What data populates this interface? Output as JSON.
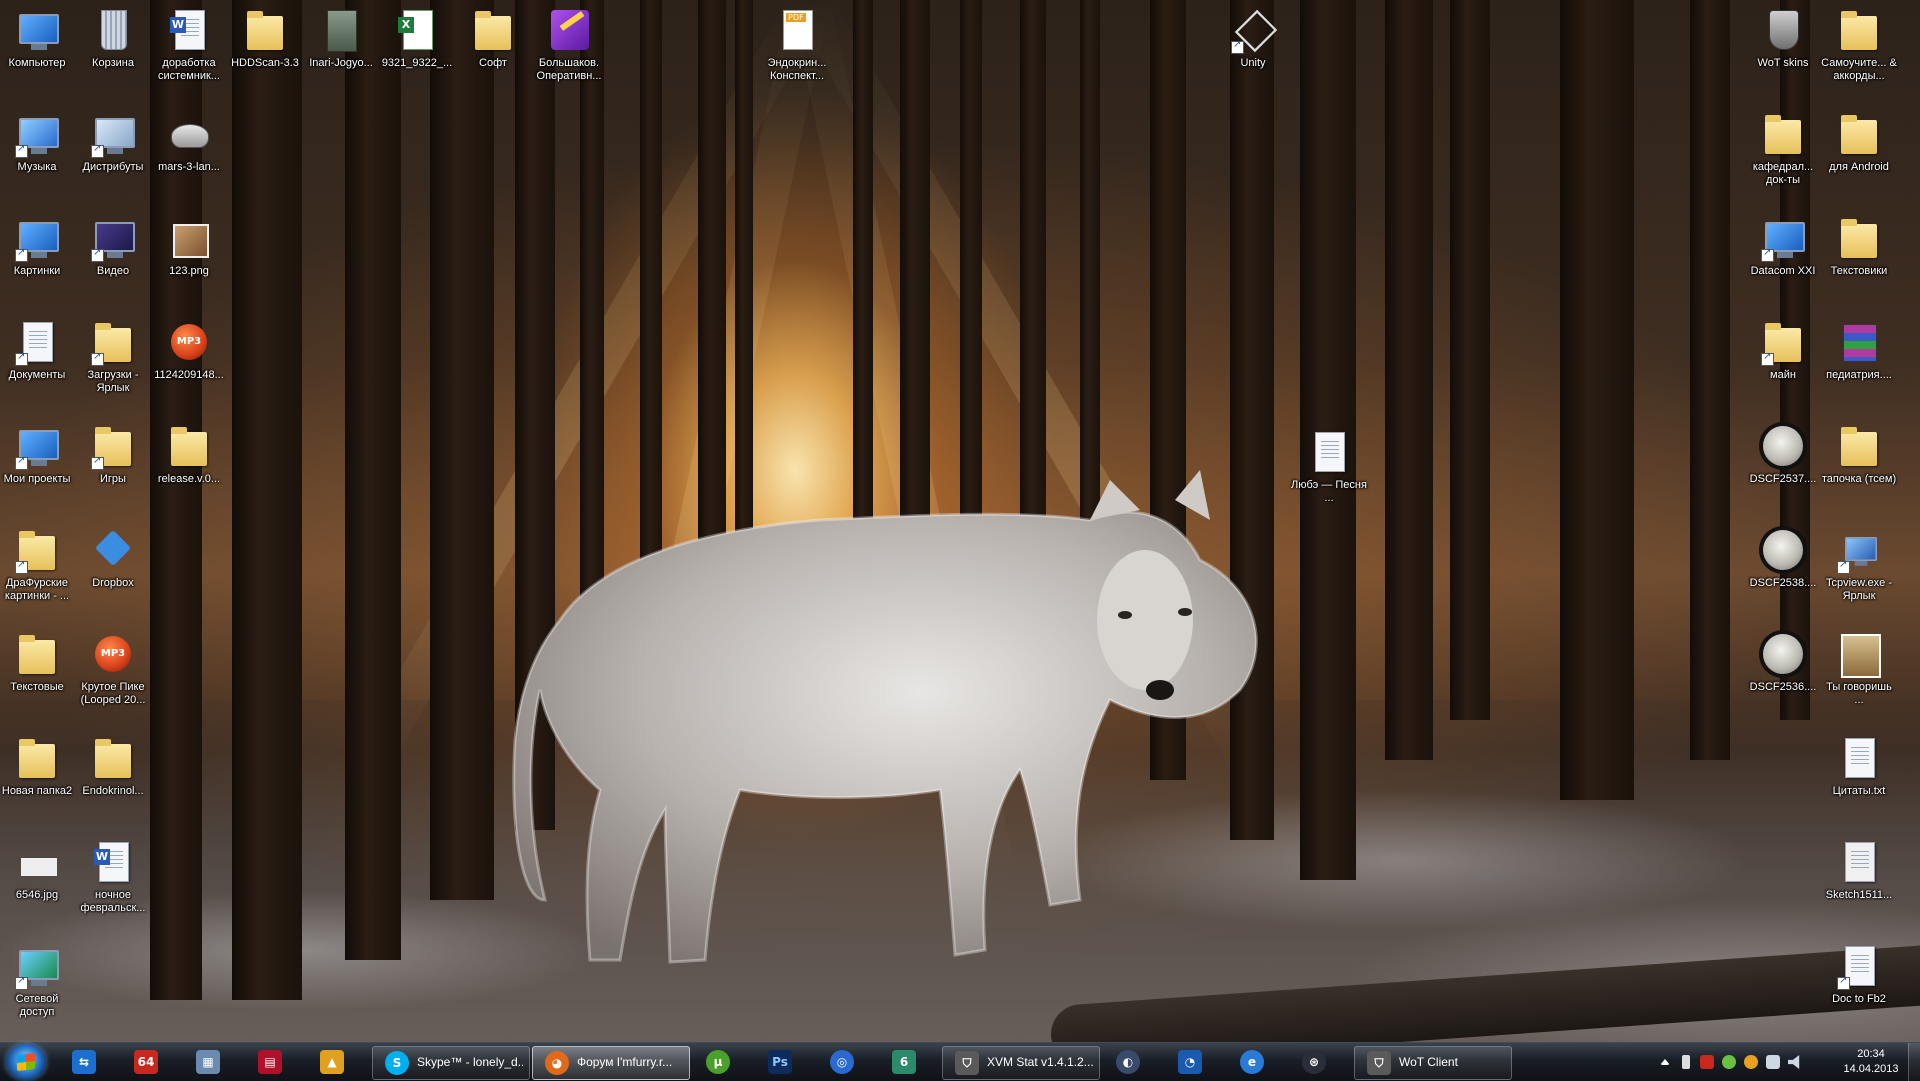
{
  "desktop": {
    "icons": [
      {
        "id": "computer",
        "label": "Компьютер",
        "icon": "computer-icon"
      },
      {
        "id": "recycle",
        "label": "Корзина",
        "icon": "recycle-bin-icon"
      },
      {
        "id": "dorabotka",
        "label": "доработка системник...",
        "icon": "word-document-icon"
      },
      {
        "id": "hddscan",
        "label": "HDDScan-3.3",
        "icon": "folder-icon"
      },
      {
        "id": "inari",
        "label": "Inari-Jogyo...",
        "icon": "game-icon"
      },
      {
        "id": "xls9321",
        "label": "9321_9322_...",
        "icon": "excel-document-icon"
      },
      {
        "id": "soft",
        "label": "Софт",
        "icon": "folder-icon"
      },
      {
        "id": "bolshakov",
        "label": "Большаков. Оперативн...",
        "icon": "onenote-icon"
      },
      {
        "id": "endokrin",
        "label": "Эндокрин... Конспект...",
        "icon": "pdf-icon"
      },
      {
        "id": "unity",
        "label": "Unity",
        "icon": "unity-icon"
      },
      {
        "id": "wotskins",
        "label": "WoT skins",
        "icon": "wot-icon"
      },
      {
        "id": "samouch",
        "label": "Самоучите... & аккорды...",
        "icon": "folder-icon"
      },
      {
        "id": "music",
        "label": "Музыка",
        "icon": "music-icon"
      },
      {
        "id": "distrib",
        "label": "Дистрибуты",
        "icon": "computer-icon"
      },
      {
        "id": "mars",
        "label": "mars-3-lan...",
        "icon": "game-icon"
      },
      {
        "id": "kafedral",
        "label": "кафедрал... док-ты",
        "icon": "folder-icon"
      },
      {
        "id": "android",
        "label": "для Android",
        "icon": "folder-icon"
      },
      {
        "id": "pictures",
        "label": "Картинки",
        "icon": "pictures-icon"
      },
      {
        "id": "video",
        "label": "Видео",
        "icon": "video-icon"
      },
      {
        "id": "png123",
        "label": "123.png",
        "icon": "image-icon"
      },
      {
        "id": "datacom",
        "label": "Datacom XXI",
        "icon": "network-icon"
      },
      {
        "id": "textoviki",
        "label": "Текстовики",
        "icon": "folder-icon"
      },
      {
        "id": "docs",
        "label": "Документы",
        "icon": "documents-icon"
      },
      {
        "id": "downloads",
        "label": "Загрузки - Ярлык",
        "icon": "folder-icon"
      },
      {
        "id": "mp3a",
        "label": "1124209148...",
        "icon": "mp3-icon"
      },
      {
        "id": "main",
        "label": "майн",
        "icon": "folder-icon"
      },
      {
        "id": "pediatr",
        "label": "педиатрия....",
        "icon": "winrar-icon"
      },
      {
        "id": "projects",
        "label": "Мои проекты",
        "icon": "computer-icon"
      },
      {
        "id": "games",
        "label": "Игры",
        "icon": "folder-icon"
      },
      {
        "id": "release",
        "label": "release.v.0...",
        "icon": "folder-icon"
      },
      {
        "id": "lyubz",
        "label": "Любэ — Песня ...",
        "icon": "text-document-icon"
      },
      {
        "id": "dscf2537",
        "label": "DSCF2537....",
        "icon": "moon-photo-icon"
      },
      {
        "id": "tapochka",
        "label": "тапочка (тсем)",
        "icon": "folder-icon"
      },
      {
        "id": "drafur",
        "label": "ДраФурские картинки - ...",
        "icon": "folder-icon"
      },
      {
        "id": "dropbox",
        "label": "Dropbox",
        "icon": "dropbox-icon"
      },
      {
        "id": "dscf2538",
        "label": "DSCF2538....",
        "icon": "moon-photo-icon"
      },
      {
        "id": "tcpview",
        "label": "Tcpview.exe - Ярлык",
        "icon": "network-icon"
      },
      {
        "id": "textovye",
        "label": "Текстовые",
        "icon": "folder-icon"
      },
      {
        "id": "krutoe",
        "label": "Крутое Пике (Looped 20...",
        "icon": "mp3-icon"
      },
      {
        "id": "dscf2536",
        "label": "DSCF2536....",
        "icon": "moon-photo-icon"
      },
      {
        "id": "ty",
        "label": "Ты говоришь ...",
        "icon": "image-icon"
      },
      {
        "id": "novaya",
        "label": "Новая папка2",
        "icon": "folder-icon"
      },
      {
        "id": "endokrinol",
        "label": "Endokrinol...",
        "icon": "folder-icon"
      },
      {
        "id": "citaty",
        "label": "Цитаты.txt",
        "icon": "text-document-icon"
      },
      {
        "id": "jpg6546",
        "label": "6546.jpg",
        "icon": "image-icon"
      },
      {
        "id": "nochnoe",
        "label": "ночное февральск...",
        "icon": "word-document-icon"
      },
      {
        "id": "sketch",
        "label": "Sketch1511...",
        "icon": "image-icon"
      },
      {
        "id": "network",
        "label": "Сетевой доступ",
        "icon": "network-icon"
      },
      {
        "id": "doc2fb2",
        "label": "Doc to Fb2",
        "icon": "text-document-icon"
      }
    ]
  },
  "taskbar": {
    "start_icon": "windows-start-icon",
    "pinned": [
      {
        "id": "teamviewer",
        "icon": "teamviewer-icon",
        "color": "#1a6fd0",
        "glyph": "⇆"
      },
      {
        "id": "aida64",
        "icon": "aida64-icon",
        "color": "#c8281e",
        "glyph": "64"
      },
      {
        "id": "calculator",
        "icon": "calculator-icon",
        "color": "#6a8ab0",
        "glyph": "▦"
      },
      {
        "id": "floppy",
        "icon": "save-icon",
        "color": "#b0102a",
        "glyph": "▤"
      },
      {
        "id": "daemon",
        "icon": "daemon-tools-icon",
        "color": "#e0a020",
        "glyph": "▲"
      }
    ],
    "windows": [
      {
        "id": "skype",
        "label": "Skype™ - lonely_d...",
        "icon": "skype-icon",
        "color": "#00aff0",
        "glyph": "S"
      },
      {
        "id": "firefox",
        "label": "Форум I'mfurry.r...",
        "icon": "firefox-icon",
        "color": "#e06a1a",
        "glyph": "◕"
      }
    ],
    "pinned2": [
      {
        "id": "utorrent",
        "icon": "utorrent-icon",
        "color": "#4aa02a",
        "glyph": "µ"
      },
      {
        "id": "photoshop",
        "icon": "photoshop-icon",
        "color": "#0f2a5c",
        "glyph": "Ps"
      },
      {
        "id": "opera",
        "icon": "browser-icon",
        "color": "#2a6ad0",
        "glyph": "◎"
      },
      {
        "id": "app6",
        "icon": "app-icon",
        "color": "#2a8a6a",
        "glyph": "6"
      }
    ],
    "windows2": [
      {
        "id": "xvm",
        "label": "XVM Stat v1.4.1.2...",
        "icon": "wot-icon",
        "color": "#5a5a5a",
        "glyph": "⛉"
      }
    ],
    "pinned3": [
      {
        "id": "app-a",
        "icon": "app-icon",
        "color": "#3a4a6a",
        "glyph": "◐"
      },
      {
        "id": "app-b",
        "icon": "app-icon",
        "color": "#1a5ab0",
        "glyph": "◔"
      },
      {
        "id": "ie",
        "icon": "internet-explorer-icon",
        "color": "#2a7ad8",
        "glyph": "e"
      },
      {
        "id": "steam",
        "icon": "steam-icon",
        "color": "#2a2e3a",
        "glyph": "⊛"
      }
    ],
    "windows3": [
      {
        "id": "wot",
        "label": "WoT Client",
        "icon": "wot-icon",
        "color": "#5a5a5a",
        "glyph": "⛉"
      }
    ],
    "tray": {
      "clock_time": "20:34",
      "clock_date": "14.04.2013"
    }
  }
}
